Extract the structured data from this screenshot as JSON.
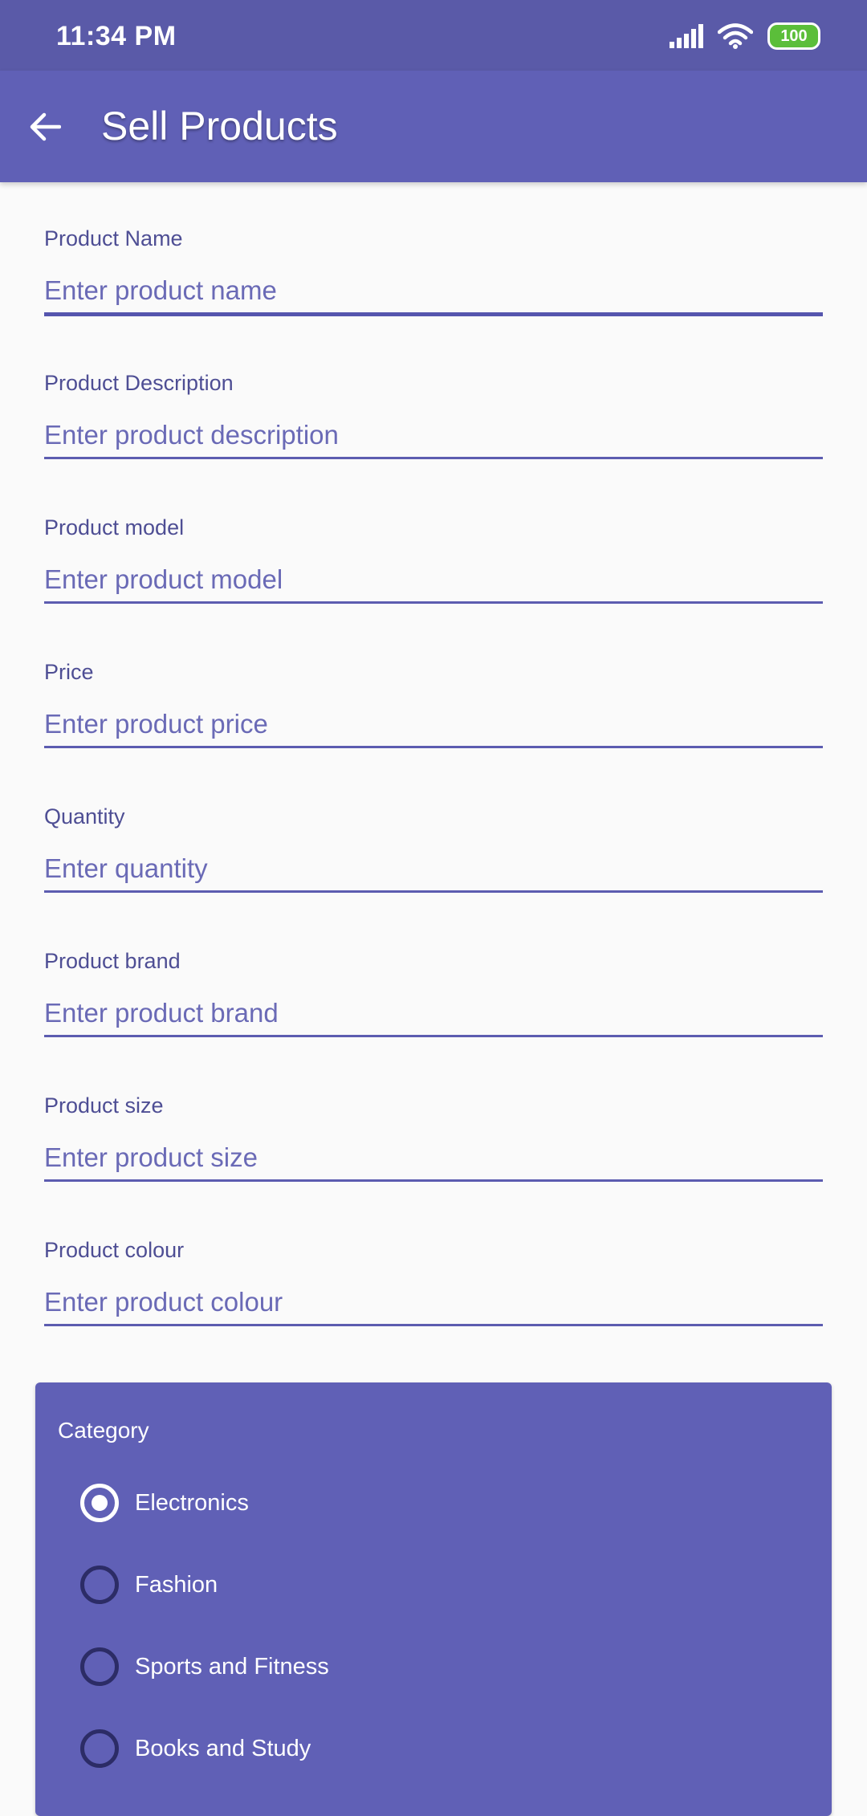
{
  "status_bar": {
    "time": "11:34 PM",
    "battery": "100",
    "battery_color": "#5BBE3A"
  },
  "app_bar": {
    "title": "Sell Products",
    "back_icon": "arrow-left-icon",
    "color": "#6060B6"
  },
  "form": {
    "fields": [
      {
        "label": "Product Name",
        "placeholder": "Enter product name",
        "value": ""
      },
      {
        "label": "Product Description",
        "placeholder": "Enter product description",
        "value": ""
      },
      {
        "label": "Product model",
        "placeholder": "Enter product model",
        "value": ""
      },
      {
        "label": "Price",
        "placeholder": "Enter product price",
        "value": ""
      },
      {
        "label": "Quantity",
        "placeholder": "Enter quantity",
        "value": ""
      },
      {
        "label": "Product brand",
        "placeholder": "Enter product brand",
        "value": ""
      },
      {
        "label": "Product size",
        "placeholder": "Enter product size",
        "value": ""
      },
      {
        "label": "Product colour",
        "placeholder": "Enter product colour",
        "value": ""
      }
    ]
  },
  "category": {
    "title": "Category",
    "selected": "Electronics",
    "options": [
      {
        "label": "Electronics",
        "selected": true
      },
      {
        "label": "Fashion",
        "selected": false
      },
      {
        "label": "Sports and Fitness",
        "selected": false
      },
      {
        "label": "Books and Study",
        "selected": false
      }
    ]
  }
}
